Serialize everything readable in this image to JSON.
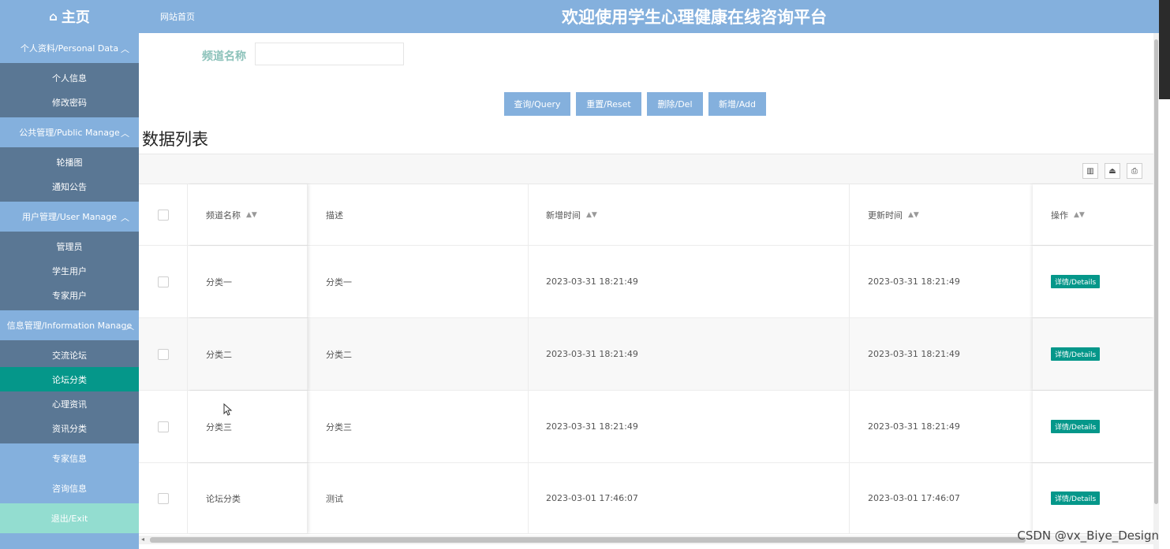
{
  "header": {
    "home_label": "主页",
    "site_link": "网站首页",
    "title": "欢迎使用学生心理健康在线咨询平台"
  },
  "sidebar": {
    "groups": [
      {
        "label": "个人资料/Personal Data",
        "items": [
          "个人信息",
          "修改密码"
        ]
      },
      {
        "label": "公共管理/Public Manage",
        "items": [
          "轮播图",
          "通知公告"
        ]
      },
      {
        "label": "用户管理/User Manage",
        "items": [
          "管理员",
          "学生用户",
          "专家用户"
        ]
      },
      {
        "label": "信息管理/Information Manage",
        "items": [
          "交流论坛",
          "论坛分类",
          "心理资讯",
          "资讯分类"
        ]
      }
    ],
    "active_item": "论坛分类",
    "singles": [
      "专家信息",
      "咨询信息"
    ],
    "exit": "退出/Exit"
  },
  "search": {
    "label": "频道名称",
    "value": "",
    "placeholder": ""
  },
  "buttons": {
    "query": "查询/Query",
    "reset": "重置/Reset",
    "delete": "删除/Del",
    "add": "新增/Add"
  },
  "section_title": "数据列表",
  "table": {
    "columns": [
      "频道名称",
      "描述",
      "新增时间",
      "更新时间",
      "操作"
    ],
    "detail_label": "详情/Details",
    "rows": [
      {
        "name": "分类一",
        "desc": "分类一",
        "created": "2023-03-31 18:21:49",
        "updated": "2023-03-31 18:21:49"
      },
      {
        "name": "分类二",
        "desc": "分类二",
        "created": "2023-03-31 18:21:49",
        "updated": "2023-03-31 18:21:49"
      },
      {
        "name": "分类三",
        "desc": "分类三",
        "created": "2023-03-31 18:21:49",
        "updated": "2023-03-31 18:21:49"
      },
      {
        "name": "论坛分类",
        "desc": "测试",
        "created": "2023-03-01 17:46:07",
        "updated": "2023-03-01 17:46:07"
      }
    ]
  },
  "watermark": "CSDN @vx_Biye_Design",
  "colors": {
    "primary": "#84b0dd",
    "sidebar_sub": "#5a7794",
    "active": "#05978a",
    "exit": "#93ddd0",
    "search_label": "#8cc2ba"
  }
}
